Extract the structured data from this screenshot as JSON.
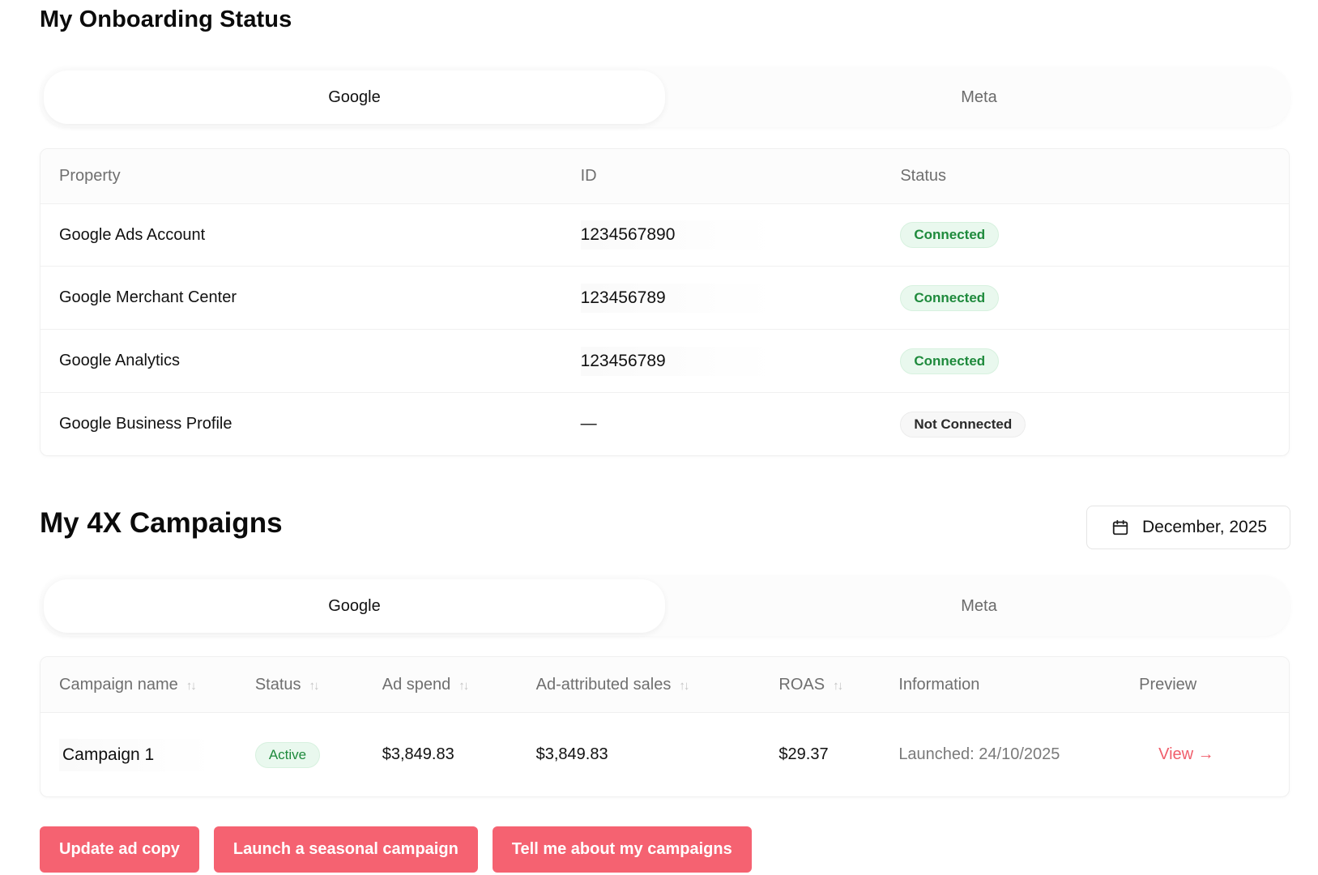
{
  "onboarding": {
    "title": "My Onboarding Status",
    "tabs": [
      {
        "label": "Google",
        "active": true
      },
      {
        "label": "Meta",
        "active": false
      }
    ],
    "columns": [
      "Property",
      "ID",
      "Status"
    ],
    "rows": [
      {
        "property": "Google Ads Account",
        "id": "1234567890",
        "status": "Connected",
        "connected": true
      },
      {
        "property": "Google Merchant Center",
        "id": "123456789",
        "status": "Connected",
        "connected": true
      },
      {
        "property": "Google Analytics",
        "id": "123456789",
        "status": "Connected",
        "connected": true
      },
      {
        "property": "Google Business Profile",
        "id": "—",
        "status": "Not Connected",
        "connected": false
      }
    ]
  },
  "campaigns": {
    "title": "My 4X Campaigns",
    "date_filter": "December, 2025",
    "tabs": [
      {
        "label": "Google",
        "active": true
      },
      {
        "label": "Meta",
        "active": false
      }
    ],
    "columns": {
      "name": "Campaign name",
      "status": "Status",
      "ad_spend": "Ad spend",
      "sales": "Ad-attributed sales",
      "roas": "ROAS",
      "info": "Information",
      "preview": "Preview"
    },
    "rows": [
      {
        "name": "Campaign 1",
        "status": "Active",
        "ad_spend": "$3,849.83",
        "sales": "$3,849.83",
        "roas": "$29.37",
        "info": "Launched: 24/10/2025",
        "preview": "View →"
      }
    ]
  },
  "actions": {
    "update_ad_copy": "Update ad copy",
    "launch_seasonal": "Launch a seasonal campaign",
    "tell_me": "Tell me about my campaigns"
  },
  "colors": {
    "accent": "#f56271",
    "connected_text": "#1e8a3c",
    "connected_bg": "#e9f8ee",
    "link": "#f05d6a"
  },
  "icons": {
    "date_filter": "calendar-icon",
    "sort": "sort-arrows-icon"
  }
}
